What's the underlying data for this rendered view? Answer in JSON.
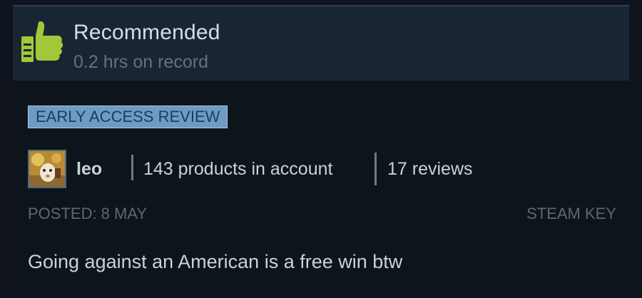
{
  "review": {
    "recommendation": "Recommended",
    "hours": "0.2 hrs on record",
    "badge": "EARLY ACCESS REVIEW",
    "author": {
      "name": "leo",
      "products": "143 products in account",
      "reviews": "17 reviews"
    },
    "posted": "POSTED: 8 MAY",
    "source": "STEAM KEY",
    "text": "Going against an American is a free win btw"
  },
  "colors": {
    "thumb": "#a4c639",
    "header_bg": "#1a2534",
    "badge_bg": "#6d9bc4"
  },
  "icons": {
    "thumb": "thumbs-up-icon"
  }
}
